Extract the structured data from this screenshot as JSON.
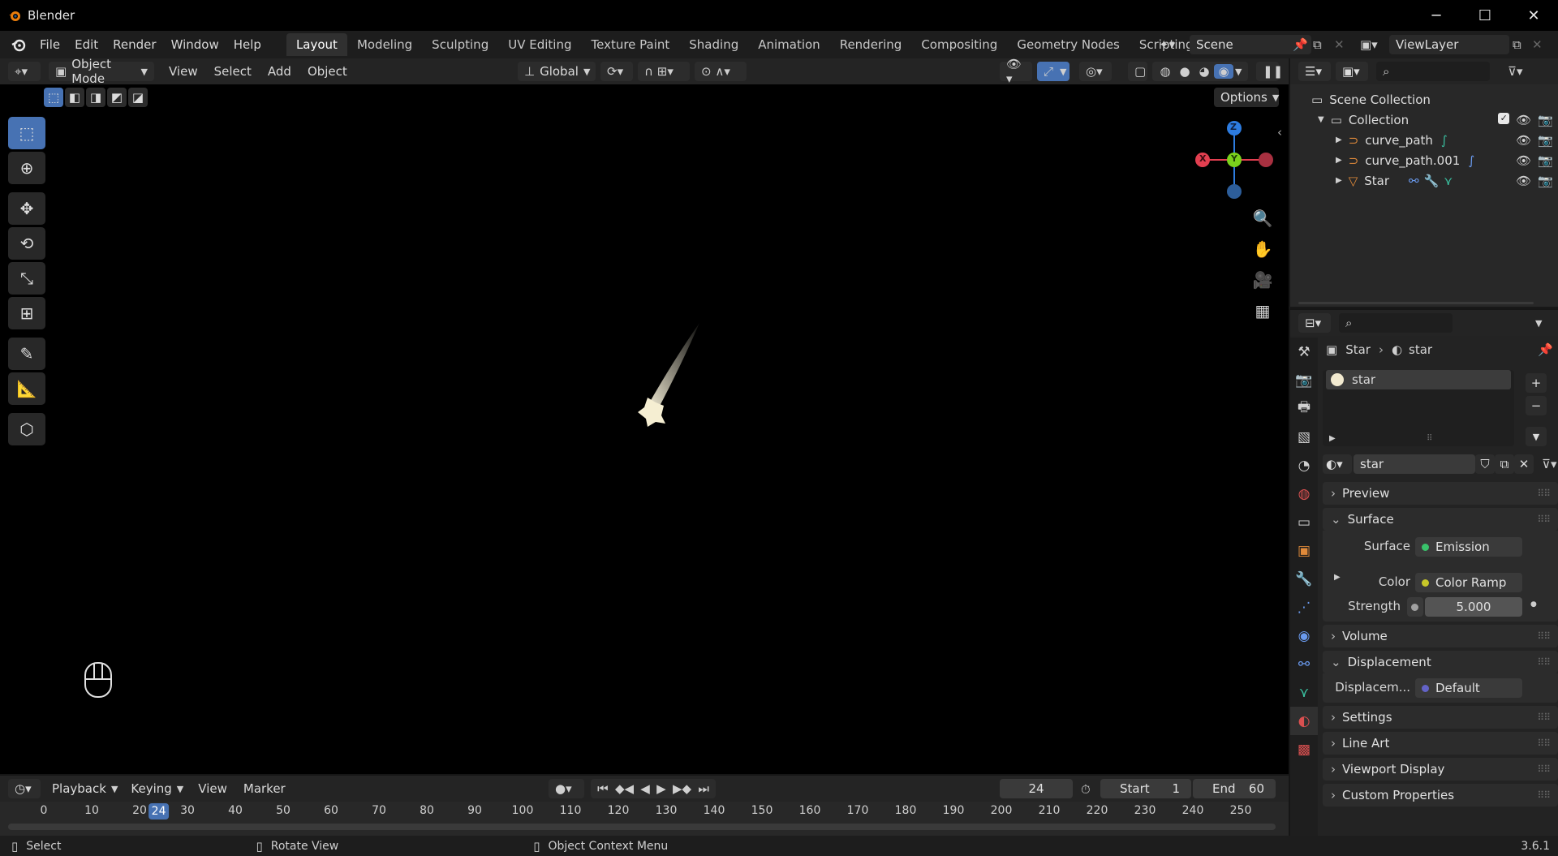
{
  "window": {
    "title": "Blender",
    "minimize": "─",
    "maximize": "☐",
    "close": "✕"
  },
  "menubar": {
    "menus": [
      "File",
      "Edit",
      "Render",
      "Window",
      "Help"
    ],
    "workspaces": [
      "Layout",
      "Modeling",
      "Sculpting",
      "UV Editing",
      "Texture Paint",
      "Shading",
      "Animation",
      "Rendering",
      "Compositing",
      "Geometry Nodes",
      "Scripting"
    ],
    "active_workspace": "Layout",
    "add_workspace": "+",
    "scene": "Scene",
    "view_layer": "ViewLayer"
  },
  "viewport_header": {
    "mode": "Object Mode",
    "menus": [
      "View",
      "Select",
      "Add",
      "Object"
    ],
    "transform_orientation": "Global",
    "options_label": "Options"
  },
  "toolbar": {
    "tools": [
      "select-box",
      "cursor",
      "move",
      "rotate",
      "scale",
      "transform",
      "annotate",
      "measure",
      "add-cube"
    ],
    "active_tool": "select-box"
  },
  "gizmo": {
    "x": "X",
    "y": "Y",
    "z": "Z",
    "colors": {
      "x": "#e23f50",
      "y": "#7ad11c",
      "z": "#2d7ce0"
    }
  },
  "outliner": {
    "root": "Scene Collection",
    "collection": "Collection",
    "items": [
      {
        "name": "curve_path",
        "icon_color": "#e08a3a"
      },
      {
        "name": "curve_path.001",
        "icon_color": "#e08a3a"
      },
      {
        "name": "Star",
        "icon_color": "#e08a3a"
      }
    ]
  },
  "properties": {
    "breadcrumb_object": "Star",
    "breadcrumb_material": "star",
    "material_slot": "star",
    "material_name": "star",
    "panels": {
      "preview": "Preview",
      "surface": "Surface",
      "volume": "Volume",
      "displacement": "Displacement",
      "settings": "Settings",
      "line_art": "Line Art",
      "viewport_display": "Viewport Display",
      "custom_properties": "Custom Properties"
    },
    "surface_label": "Surface",
    "surface_value": "Emission",
    "color_label": "Color",
    "color_value": "Color Ramp",
    "strength_label": "Strength",
    "strength_value": "5.000",
    "displacement_label": "Displacem...",
    "displacement_value": "Default"
  },
  "timeline": {
    "menus": [
      "Playback",
      "Keying",
      "View",
      "Marker"
    ],
    "current_frame": "24",
    "start_label": "Start",
    "start_value": "1",
    "end_label": "End",
    "end_value": "60",
    "ruler": [
      "0",
      "10",
      "20",
      "30",
      "40",
      "50",
      "60",
      "70",
      "80",
      "90",
      "100",
      "110",
      "120",
      "130",
      "140",
      "150",
      "160",
      "170",
      "180",
      "190",
      "200",
      "210",
      "220",
      "230",
      "240",
      "250"
    ],
    "playhead": "24"
  },
  "statusbar": {
    "select": "Select",
    "rotate_view": "Rotate View",
    "context_menu": "Object Context Menu",
    "version": "3.6.1"
  }
}
